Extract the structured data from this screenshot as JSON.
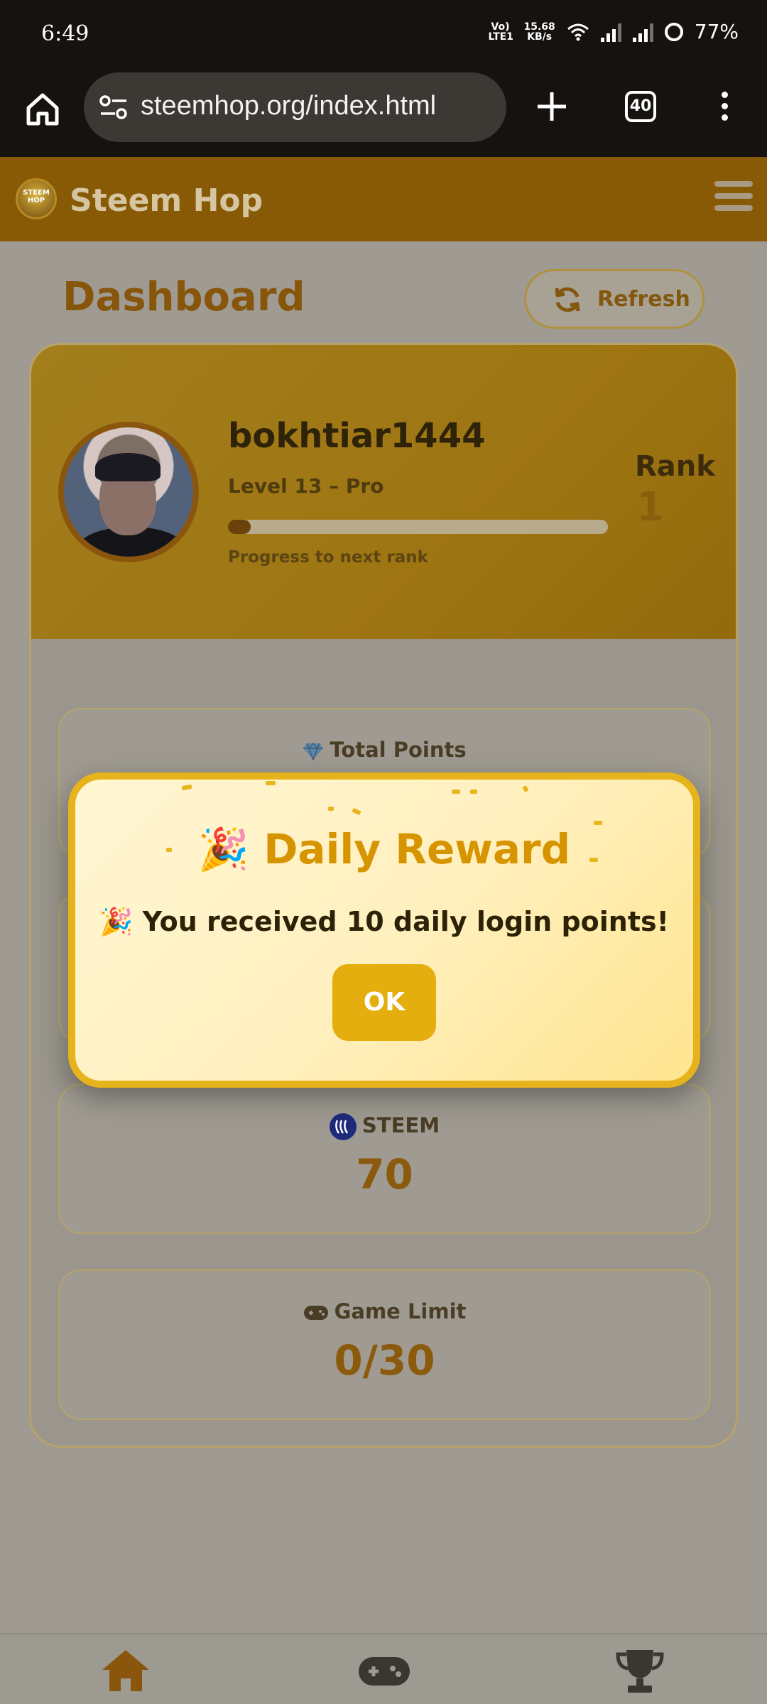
{
  "status_bar": {
    "time": "6:49",
    "network_speed": "15.68",
    "speed_unit": "KB/s",
    "carrier": "Vo) LTE1",
    "battery": "77%"
  },
  "browser": {
    "url": "steemhop.org/index.html",
    "tab_count": "40"
  },
  "app": {
    "brand": "Steem Hop",
    "logo_text": "STEEM HOP"
  },
  "dashboard": {
    "title": "Dashboard",
    "refresh_label": "Refresh"
  },
  "profile": {
    "username": "bokhtiar1444",
    "level": "Level 13 – Pro",
    "progress_label": "Progress to next rank",
    "progress_fraction": 0.06,
    "rank_label": "Rank",
    "rank_value": "1"
  },
  "stats": {
    "total_points_label": "Total Points",
    "steem_label": "STEEM",
    "steem_value": "70",
    "game_limit_label": "Game Limit",
    "game_limit_value": "0/30"
  },
  "modal": {
    "title": "Daily Reward",
    "message": "You received 10 daily login points!",
    "ok_label": "OK"
  },
  "colors": {
    "accent": "#e5ae0f",
    "header": "#895a06",
    "brand_brown": "#88560b"
  }
}
